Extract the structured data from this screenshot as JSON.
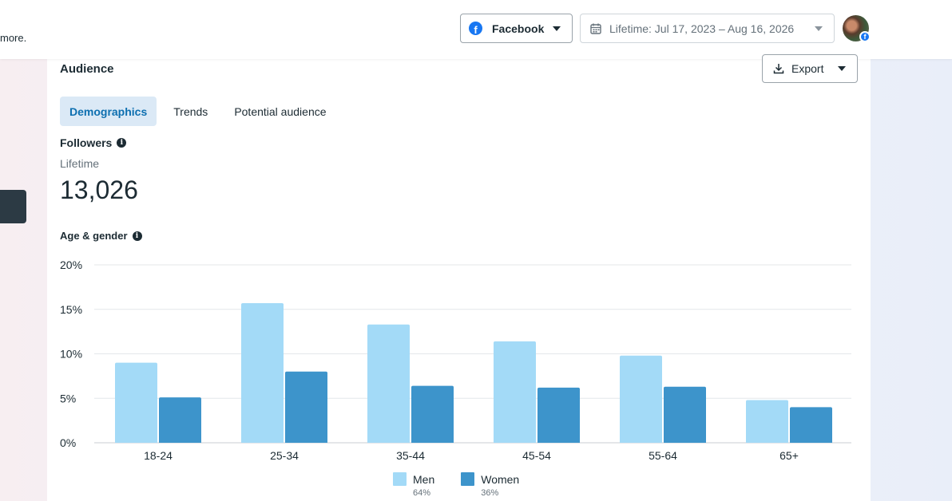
{
  "header": {
    "note_text": "more.",
    "platform": {
      "label": "Facebook",
      "icon": "facebook-icon"
    },
    "date_range": {
      "label": "Lifetime: Jul 17, 2023 – Aug 16, 2026",
      "icon": "calendar-icon"
    },
    "avatar_badge_icon": "facebook-icon"
  },
  "card": {
    "title": "Audience",
    "export_label": "Export",
    "tabs": [
      {
        "label": "Demographics",
        "active": true
      },
      {
        "label": "Trends",
        "active": false
      },
      {
        "label": "Potential audience",
        "active": false
      }
    ],
    "followers": {
      "label": "Followers",
      "sublabel": "Lifetime",
      "value": "13,026"
    },
    "age_gender_label": "Age & gender"
  },
  "colors": {
    "men": "#a3daf7",
    "women": "#3d94cb",
    "accent": "#0d6fb0"
  },
  "chart_data": {
    "type": "bar",
    "categories": [
      "18-24",
      "25-34",
      "35-44",
      "45-54",
      "55-64",
      "65+"
    ],
    "series": [
      {
        "name": "Men",
        "share": "64%",
        "values": [
          9.0,
          15.7,
          13.3,
          11.4,
          9.8,
          4.8
        ]
      },
      {
        "name": "Women",
        "share": "36%",
        "values": [
          5.1,
          8.0,
          6.4,
          6.2,
          6.3,
          4.0
        ]
      }
    ],
    "y_ticks": [
      "0%",
      "5%",
      "10%",
      "15%",
      "20%"
    ],
    "ylim": [
      0,
      20
    ],
    "grid": true,
    "legend_position": "bottom-center"
  }
}
